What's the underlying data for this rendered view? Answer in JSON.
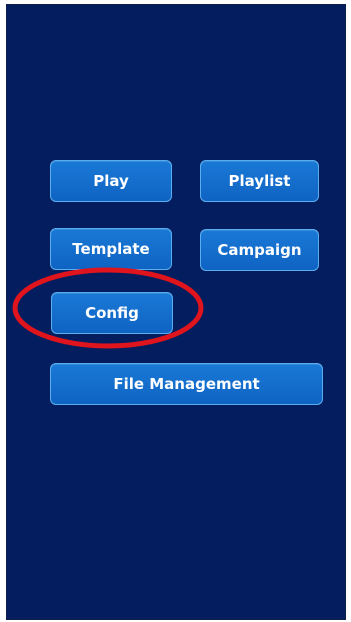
{
  "menu": {
    "play_label": "Play",
    "playlist_label": "Playlist",
    "template_label": "Template",
    "campaign_label": "Campaign",
    "config_label": "Config",
    "file_management_label": "File Management"
  },
  "colors": {
    "background": "#031d5e",
    "button": "#1a79d6",
    "button_border": "#5aaeee",
    "highlight": "#e0141c"
  },
  "annotation": {
    "highlighted_item": "config"
  }
}
